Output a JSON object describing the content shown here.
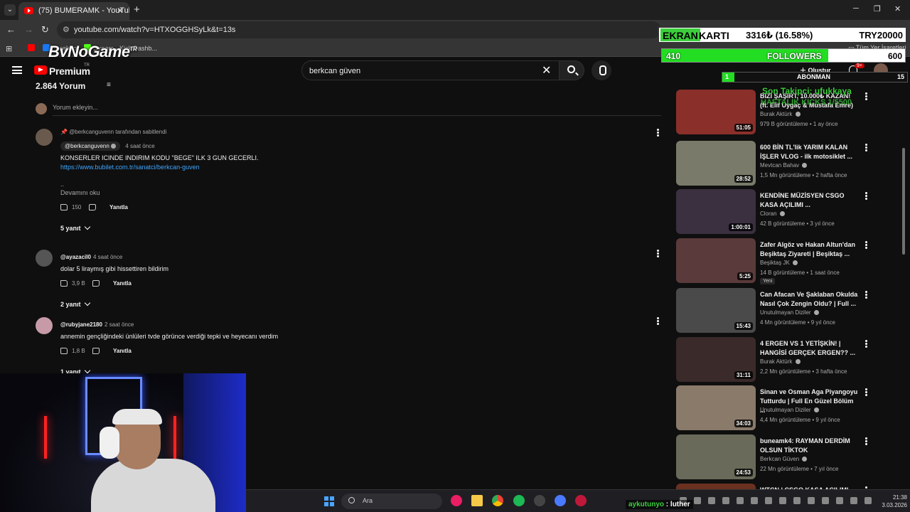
{
  "browser": {
    "tab_title": "(75) BUMERAMK - YouTube",
    "url": "youtube.com/watch?v=HTXOGGHSyLk&t=13s",
    "bookmarks": [
      "Facebook",
      "Stream - Kick Dashb..."
    ],
    "bookmarks_right": "Tüm Yer İşaretleri"
  },
  "overlay": {
    "brand": "ByNoGame",
    "brand_sup": "TR",
    "ekran_label_a": "EKRAN",
    "ekran_label_b": "KARTI",
    "ekran_value": "3316₺ (16.58%)",
    "ekran_goal": "TRY20000",
    "followers_current": "410",
    "followers_label": "FOLLOWERS",
    "followers_goal": "600",
    "followers_progress": 0.683,
    "abone_current": "1",
    "abone_label": "ABONMAN",
    "abone_goal": "15",
    "abone_progress": 0.067,
    "last_follower": "Son Takipci: ufukkaya",
    "kicks_goal": "HAFTALIK KICKS 1/5500"
  },
  "yt": {
    "premium": "Premium",
    "premium_tr": "TR",
    "search_value": "berkcan güven",
    "create": "Oluştur",
    "notif_count": "9+"
  },
  "comments": {
    "count": "2.864 Yorum",
    "sort_label": "Sıralama ölçütü",
    "add_placeholder": "Yorum ekleyin...",
    "items": [
      {
        "pinned_by": "@berkcanguvenn tarafından sabitlendi",
        "author": "@berkcanguvenn",
        "time": "4 saat önce",
        "text": "KONSERLER ICINDE INDIRIM KODU \"BEGE\" ILK 3 GUN GECERLI.",
        "link": "https://www.bubilet.com.tr/sanatci/berkcan-guven",
        "ellipsis": "..",
        "read_more": "Devamını oku",
        "likes": "150",
        "reply": "Yanıtla",
        "replies": "5 yanıt"
      },
      {
        "author": "@ayazacil0",
        "time": "4 saat önce",
        "text": "dolar 5 liraymış gibi hissettiren bildirim",
        "likes": "3,9 B",
        "reply": "Yanıtla",
        "replies": "2 yanıt"
      },
      {
        "author": "@rubyjane2180",
        "time": "2 saat önce",
        "text": "annemin gençliğindeki ünlüleri tvde görünce verdiği tepki ve heyecanı verdim",
        "likes": "1,8 B",
        "reply": "Yanıtla",
        "replies": "1 yanıt"
      }
    ]
  },
  "related": [
    {
      "title": "BİZİ ŞAŞIRT, 10.000₺ KAZAN! (ft. Elif Uygaç & Mustafa Emre)",
      "channel": "Burak Aktürk",
      "meta": "979 B görüntüleme • 1 ay önce",
      "duration": "51:05",
      "color": "#8a2f2a"
    },
    {
      "title": "600 BİN TL'lik YARIM KALAN İŞLER VLOG - ilk motosiklet ...",
      "channel": "Mevtcan Bahav",
      "meta": "1,5 Mn görüntüleme • 2 hafta önce",
      "duration": "28:52",
      "color": "#7a7a6a"
    },
    {
      "title": "KENDİNE MÜZİSYEN CSGO KASA AÇILIMI ...",
      "channel": "Cloran",
      "meta": "42 B görüntüleme • 3 yıl önce",
      "duration": "1:00:01",
      "color": "#3a3040"
    },
    {
      "title": "Zafer Algöz ve Hakan Altun'dan Beşiktaş Ziyareti | Beşiktaş ...",
      "channel": "Beşiktaş JK",
      "meta": "14 B görüntüleme • 1 saat önce",
      "duration": "5:25",
      "color": "#5a3a3a",
      "badge": "Yeni"
    },
    {
      "title": "Can Afacan Ve Şaklaban Okulda Nasıl Çok Zengin Oldu? | Full ...",
      "channel": "Unutulmayan Diziler",
      "meta": "4 Mn görüntüleme • 9 yıl önce",
      "duration": "15:43",
      "color": "#4a4a4a"
    },
    {
      "title": "4 ERGEN VS 1 YETİŞKİN! | HANGİSİ GERÇEK ERGEN?? ...",
      "channel": "Burak Aktürk",
      "meta": "2,2 Mn görüntüleme • 3 hafta önce",
      "duration": "31:11",
      "color": "#3a2a2a"
    },
    {
      "title": "Sinan ve Osman Aga Piyangoyu Tutturdu | Full En Güzel Bölüm ...",
      "channel": "Unutulmayan Diziler",
      "meta": "4,4 Mn görüntüleme • 9 yıl önce",
      "duration": "34:03",
      "color": "#8a7a6a"
    },
    {
      "title": "buneamk4: RAYMAN DERDİM OLSUN TİKTOK",
      "channel": "Berkcan Güven",
      "meta": "22 Mn görüntüleme • 7 yıl önce",
      "duration": "24:53",
      "color": "#6a6a5a"
    },
    {
      "title": "WTCN | CSGO KASA AÇILIMI ...",
      "channel": "",
      "meta": "",
      "duration": "",
      "color": "#6a3020"
    }
  ],
  "taskbar": {
    "search": "Ara",
    "time": "21:38",
    "date": "3.03.2026"
  },
  "chat": {
    "user": "aykutunyo",
    "sep": ":",
    "message": "luther"
  }
}
